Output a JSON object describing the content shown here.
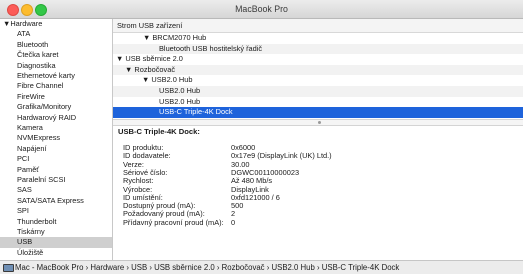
{
  "window": {
    "title": "MacBook Pro"
  },
  "sidebar": {
    "header": "Hardware",
    "items": [
      "ATA",
      "Bluetooth",
      "Čtečka karet",
      "Diagnostika",
      "Ethernetové karty",
      "Fibre Channel",
      "FireWire",
      "Grafika/Monitory",
      "Hardwarový RAID",
      "Kamera",
      "NVMExpress",
      "Napájení",
      "PCI",
      "Paměť",
      "Paralelní SCSI",
      "SAS",
      "SATA/SATA Express",
      "SPI",
      "Thunderbolt",
      "Tiskárny",
      "USB",
      "Úložiště"
    ],
    "selected": "USB"
  },
  "tree": {
    "header": "Strom USB zařízení",
    "rows": [
      {
        "label": "BRCM2070 Hub",
        "prefix": "▼ "
      },
      {
        "label": "Bluetooth USB hostitelský řadič",
        "prefix": ""
      },
      {
        "label": "USB sběrnice 2.0",
        "prefix": "▼ "
      },
      {
        "label": "Rozbočovač",
        "prefix": "▼ "
      },
      {
        "label": "USB2.0 Hub",
        "prefix": "▼ "
      },
      {
        "label": "USB2.0 Hub",
        "prefix": ""
      },
      {
        "label": "USB2.0 Hub",
        "prefix": ""
      },
      {
        "label": "USB-C Triple-4K Dock",
        "prefix": ""
      }
    ],
    "selected_index": 7
  },
  "detail": {
    "title": "USB-C Triple-4K Dock:",
    "rows": [
      {
        "label": "ID produktu:",
        "value": "0x6000"
      },
      {
        "label": "ID dodavatele:",
        "value": "0x17e9  (DisplayLink (UK) Ltd.)"
      },
      {
        "label": "Verze:",
        "value": "30.00"
      },
      {
        "label": "Sériové číslo:",
        "value": "DGWC00110000023"
      },
      {
        "label": "Rychlost:",
        "value": "Až 480 Mb/s"
      },
      {
        "label": "Výrobce:",
        "value": "DisplayLink"
      },
      {
        "label": "ID umístění:",
        "value": "0xfd121000 / 6"
      },
      {
        "label": "Dostupný proud (mA):",
        "value": "500"
      },
      {
        "label": "Požadovaný proud (mA):",
        "value": "2"
      },
      {
        "label": "Přídavný pracovní proud (mA):",
        "value": "0"
      }
    ]
  },
  "pathbar": {
    "path": "Mac - MacBook Pro › Hardware › USB › USB sběrnice 2.0 › Rozbočovač › USB2.0 Hub › USB-C Triple-4K Dock",
    "icon": "computer-icon"
  },
  "colors": {
    "selection": "#1e63db",
    "sidebar_selection": "#cfcfcf"
  }
}
